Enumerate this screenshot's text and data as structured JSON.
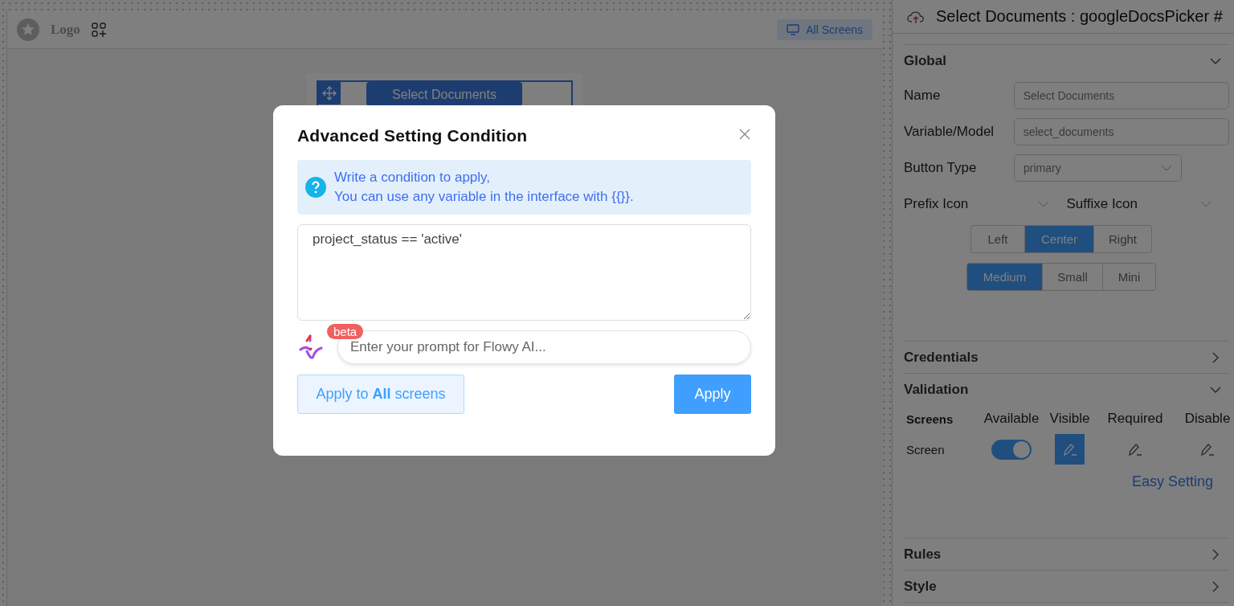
{
  "canvas": {
    "logo": "Logo",
    "screens_button": "All Screens",
    "component_button": "Select Documents"
  },
  "panel": {
    "title": "Select Documents : googleDocsPicker #",
    "global": {
      "title": "Global",
      "expanded": true,
      "fields": [
        {
          "label": "Name",
          "kind": "input",
          "value": "Select Documents"
        },
        {
          "label": "Variable/Model",
          "kind": "input",
          "value": "select_documents"
        },
        {
          "label": "Button Type",
          "kind": "select",
          "value": "primary"
        }
      ],
      "icon_pickers": [
        {
          "label": "Prefix Icon"
        },
        {
          "label": "Suffixe Icon"
        }
      ],
      "alignment": [
        {
          "label": "Left",
          "selected": false
        },
        {
          "label": "Center",
          "selected": true
        },
        {
          "label": "Right",
          "selected": false
        }
      ],
      "sizes": [
        {
          "label": "Medium",
          "selected": true
        },
        {
          "label": "Small",
          "selected": false
        },
        {
          "label": "Mini",
          "selected": false
        }
      ]
    },
    "credentials": {
      "title": "Credentials",
      "expanded": false
    },
    "validation": {
      "title": "Validation",
      "expanded": true,
      "columns": [
        "Screens",
        "Available",
        "Visible",
        "Required",
        "Disable"
      ],
      "rows": [
        {
          "label": "Screen",
          "available": true,
          "visible": true,
          "required": false,
          "disable": false
        }
      ],
      "easy_setting": "Easy Setting"
    },
    "rules": {
      "title": "Rules",
      "expanded": false
    },
    "style": {
      "title": "Style",
      "expanded": false
    }
  },
  "modal": {
    "title": "Advanced Setting Condition",
    "info_lines": [
      "Write a condition to apply,",
      "You can use any variable in the interface with {{}}."
    ],
    "condition": "project_status == 'active'",
    "beta": "beta",
    "prompt_placeholder": "Enter your prompt for Flowy AI...",
    "apply_all": "Apply to **All** screens",
    "apply": "Apply"
  }
}
